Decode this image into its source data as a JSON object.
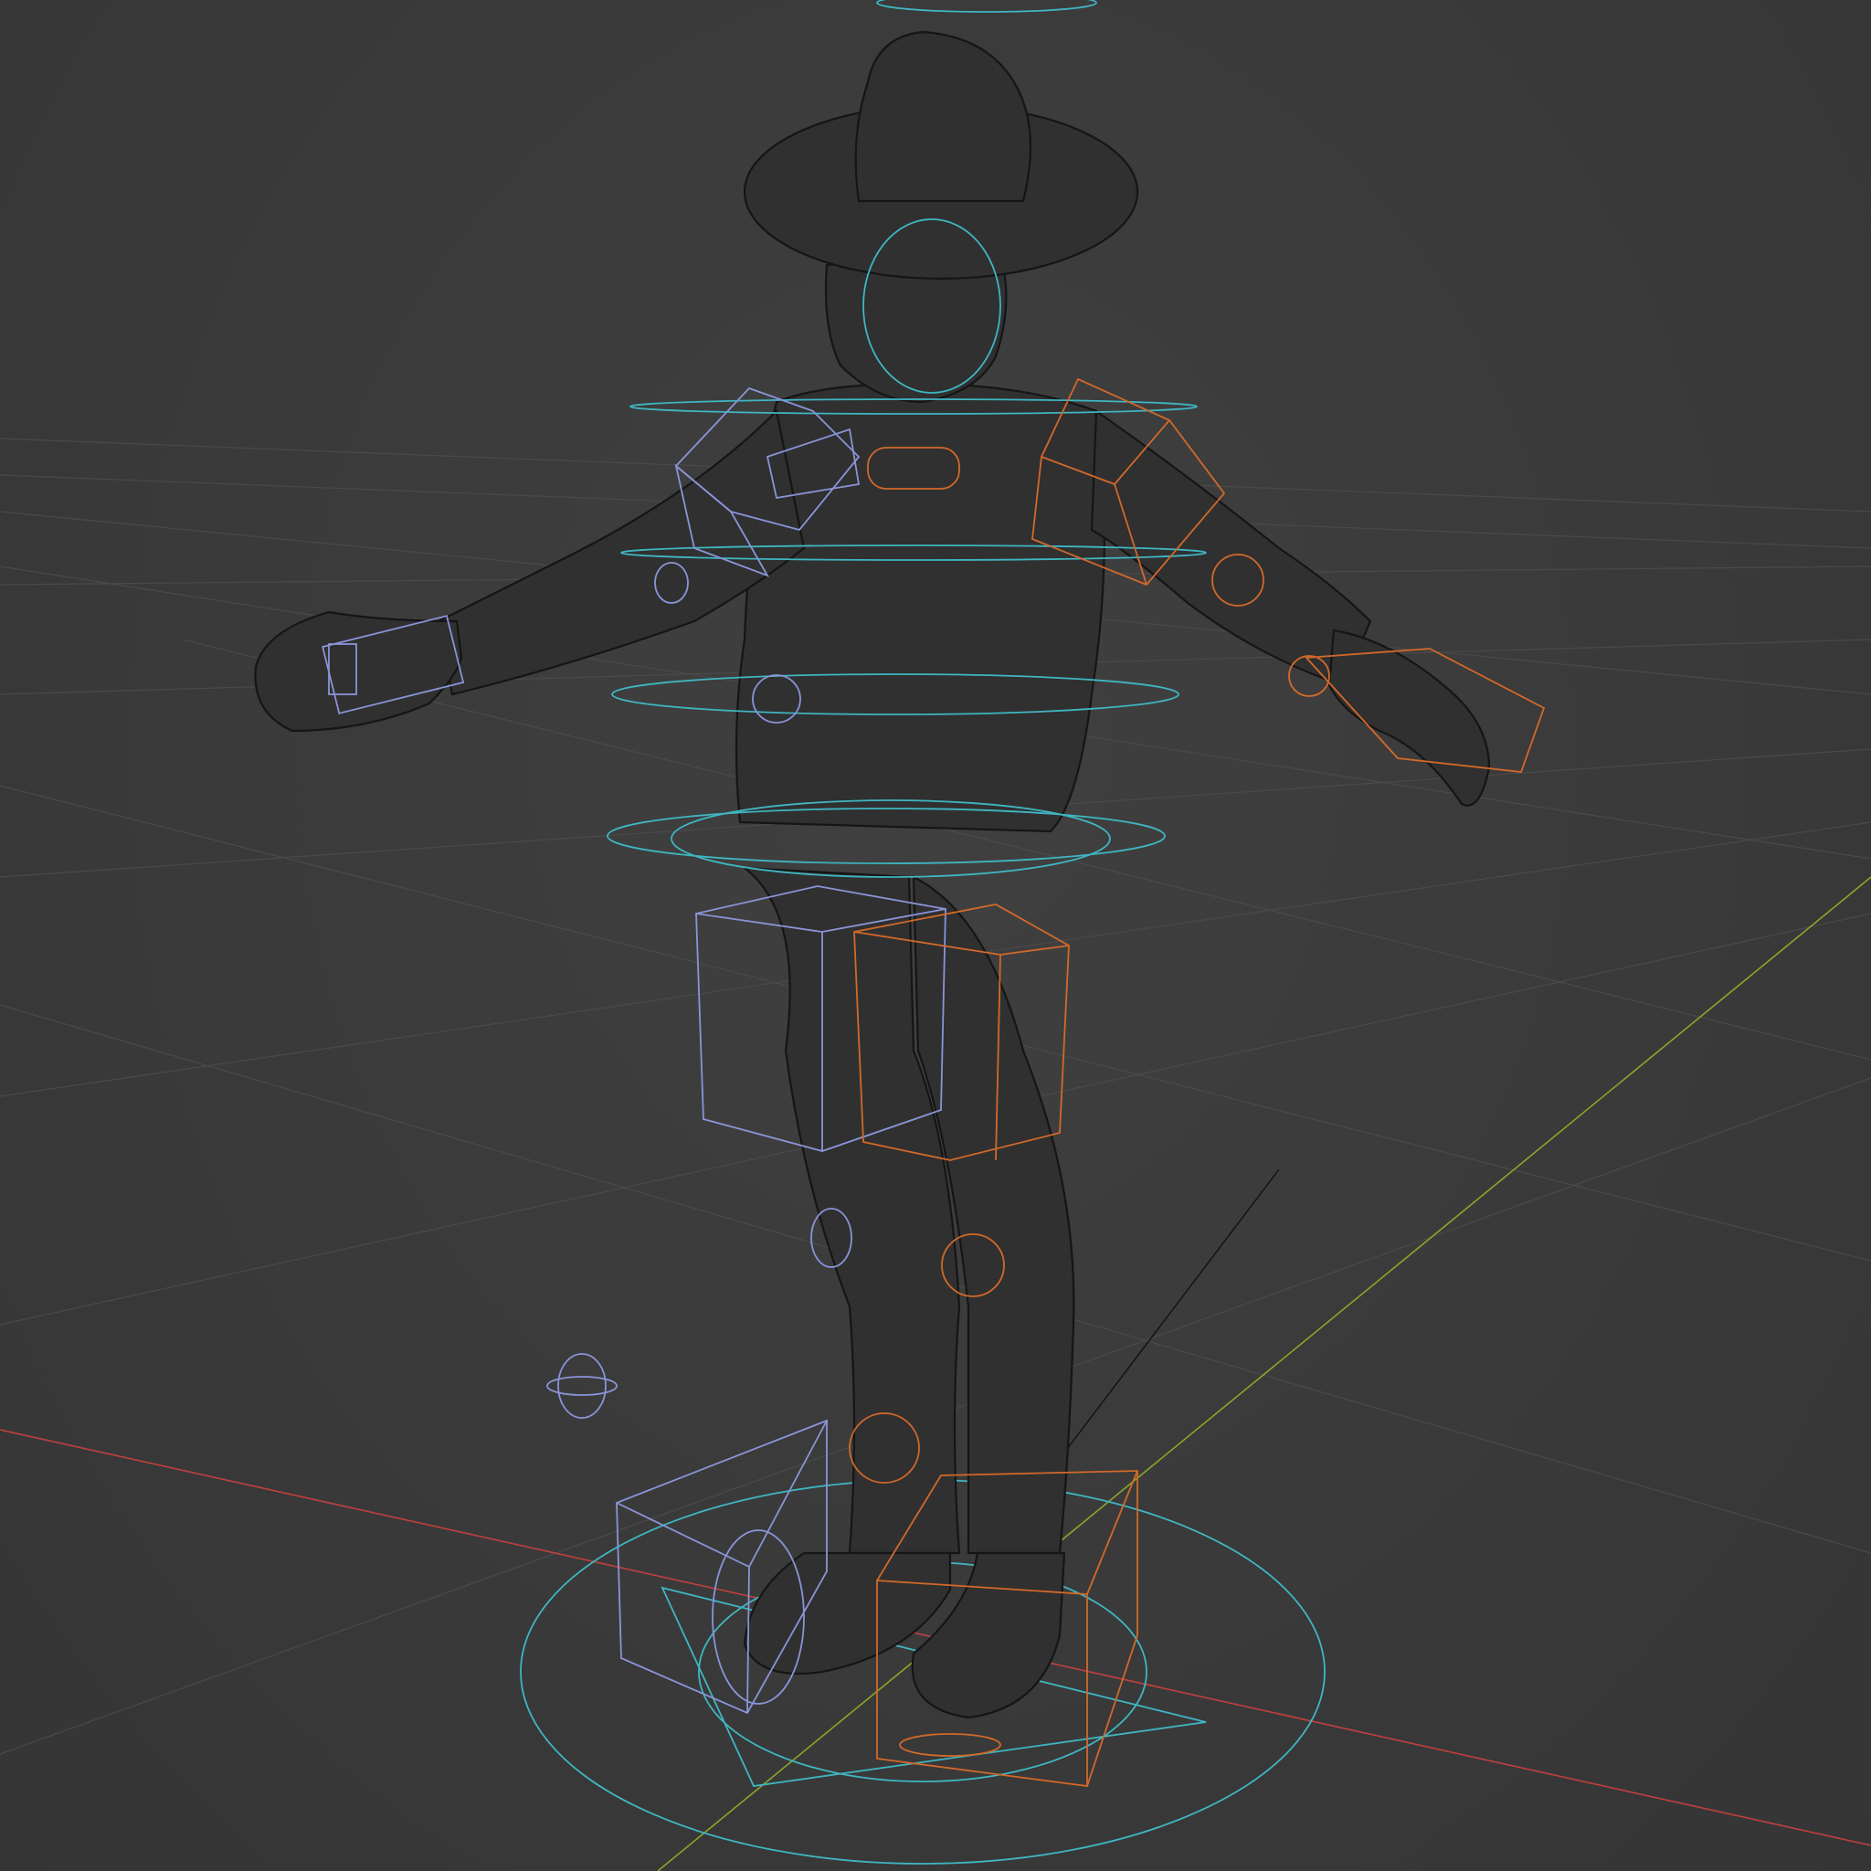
{
  "viewport": {
    "mode": "wireframe",
    "background": "#3c3c3c",
    "grid_color": "#4a4a4a",
    "axis_colors": {
      "x": "#c0403f",
      "y": "#8aa52a",
      "z": "#3fb6c2"
    }
  },
  "scene": {
    "object": "character-mesh",
    "rig": "control-rig",
    "control_colors": {
      "left_side": "#8a94d8",
      "right_side": "#d2692a",
      "center": "#3fb6c2"
    },
    "mesh_colors": {
      "fill": "#303030",
      "wire": "#1a1a1a"
    }
  },
  "icons": [
    "x-axis-icon",
    "y-axis-icon",
    "floor-grid-icon"
  ]
}
